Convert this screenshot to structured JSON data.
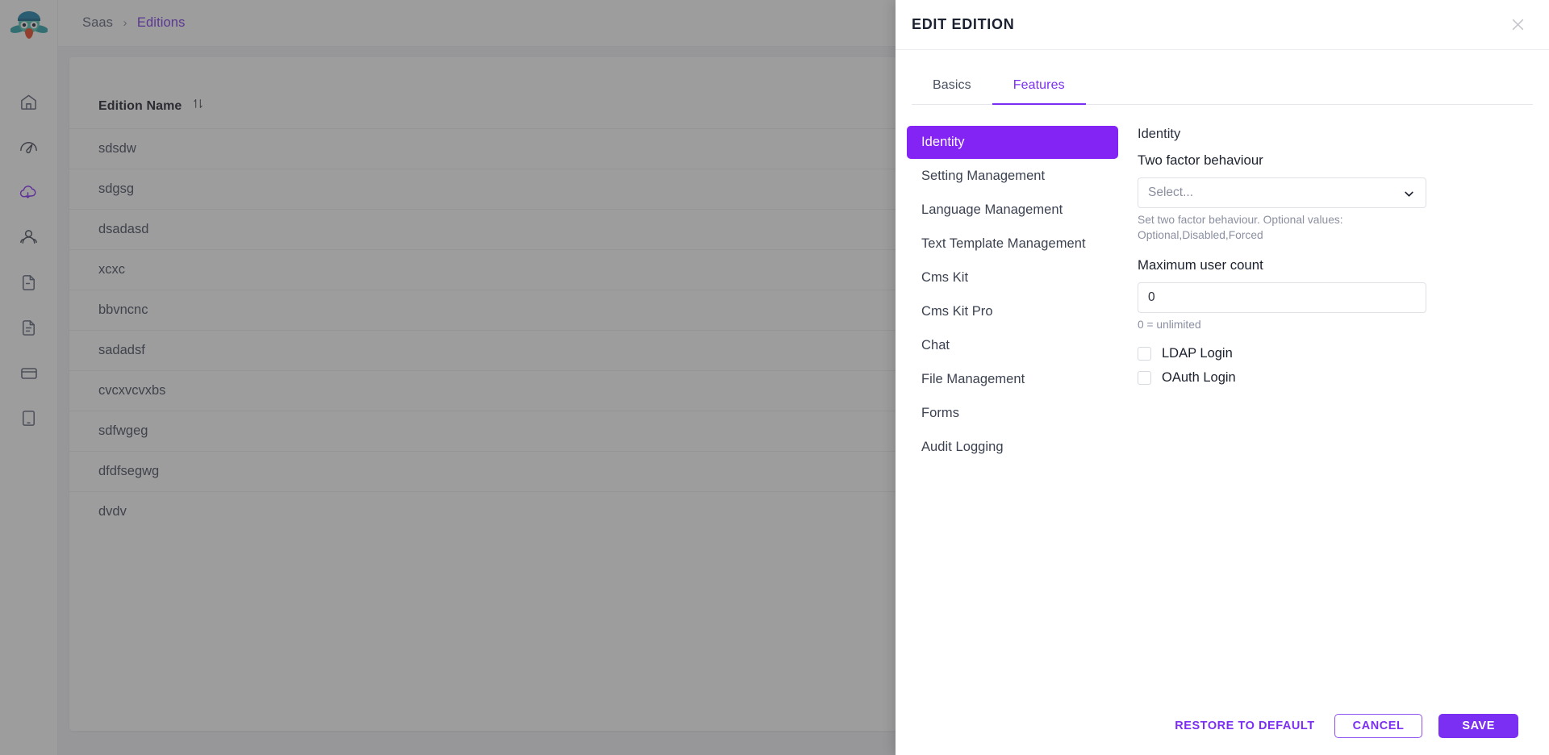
{
  "breadcrumb": {
    "root": "Saas",
    "separator": "›",
    "current": "Editions"
  },
  "sidebar": {
    "items": [
      {
        "icon": "home-icon",
        "name": "home"
      },
      {
        "icon": "dashboard-gauge-icon",
        "name": "dashboard"
      },
      {
        "icon": "cloud-saas-icon",
        "name": "saas",
        "active": true
      },
      {
        "icon": "users-icon",
        "name": "administration"
      },
      {
        "icon": "document-icon",
        "name": "documents"
      },
      {
        "icon": "document-text-icon",
        "name": "text-templates"
      },
      {
        "icon": "credit-card-icon",
        "name": "payment"
      },
      {
        "icon": "tablet-icon",
        "name": "device"
      }
    ]
  },
  "table": {
    "column_header": "Edition Name",
    "sort_icon": "sort-updown-icon",
    "rows": [
      "sdsdw",
      "sdgsg",
      "dsadasd",
      "xcxc",
      "bbvncnc",
      "sadadsf",
      "cvcxvcvxbs",
      "sdfwgeg",
      "dfdfsegwg",
      "dvdv"
    ]
  },
  "panel": {
    "title": "EDIT EDITION",
    "close_icon": "close-icon",
    "tabs": [
      {
        "label": "Basics",
        "active": false
      },
      {
        "label": "Features",
        "active": true
      }
    ],
    "features": [
      {
        "label": "Identity",
        "active": true
      },
      {
        "label": "Setting Management",
        "active": false
      },
      {
        "label": "Language Management",
        "active": false
      },
      {
        "label": "Text Template Management",
        "active": false
      },
      {
        "label": "Cms Kit",
        "active": false
      },
      {
        "label": "Cms Kit Pro",
        "active": false
      },
      {
        "label": "Chat",
        "active": false
      },
      {
        "label": "File Management",
        "active": false
      },
      {
        "label": "Forms",
        "active": false
      },
      {
        "label": "Audit Logging",
        "active": false
      }
    ],
    "detail": {
      "group_title": "Identity",
      "two_factor": {
        "label": "Two factor behaviour",
        "placeholder": "Select...",
        "value": "",
        "chevron_icon": "chevron-down-icon",
        "hint": "Set two factor behaviour. Optional values: Optional,Disabled,Forced"
      },
      "max_user_count": {
        "label": "Maximum user count",
        "value": "0",
        "hint": "0 = unlimited"
      },
      "checkboxes": [
        {
          "label": "LDAP Login",
          "checked": false
        },
        {
          "label": "OAuth Login",
          "checked": false
        }
      ]
    },
    "footer": {
      "restore_label": "RESTORE TO DEFAULT",
      "cancel_label": "CANCEL",
      "save_label": "SAVE"
    }
  },
  "colors": {
    "accent": "#7b2ff2",
    "feature_active": "#8324f5",
    "scrim": "rgba(60,60,60,0.50)"
  }
}
